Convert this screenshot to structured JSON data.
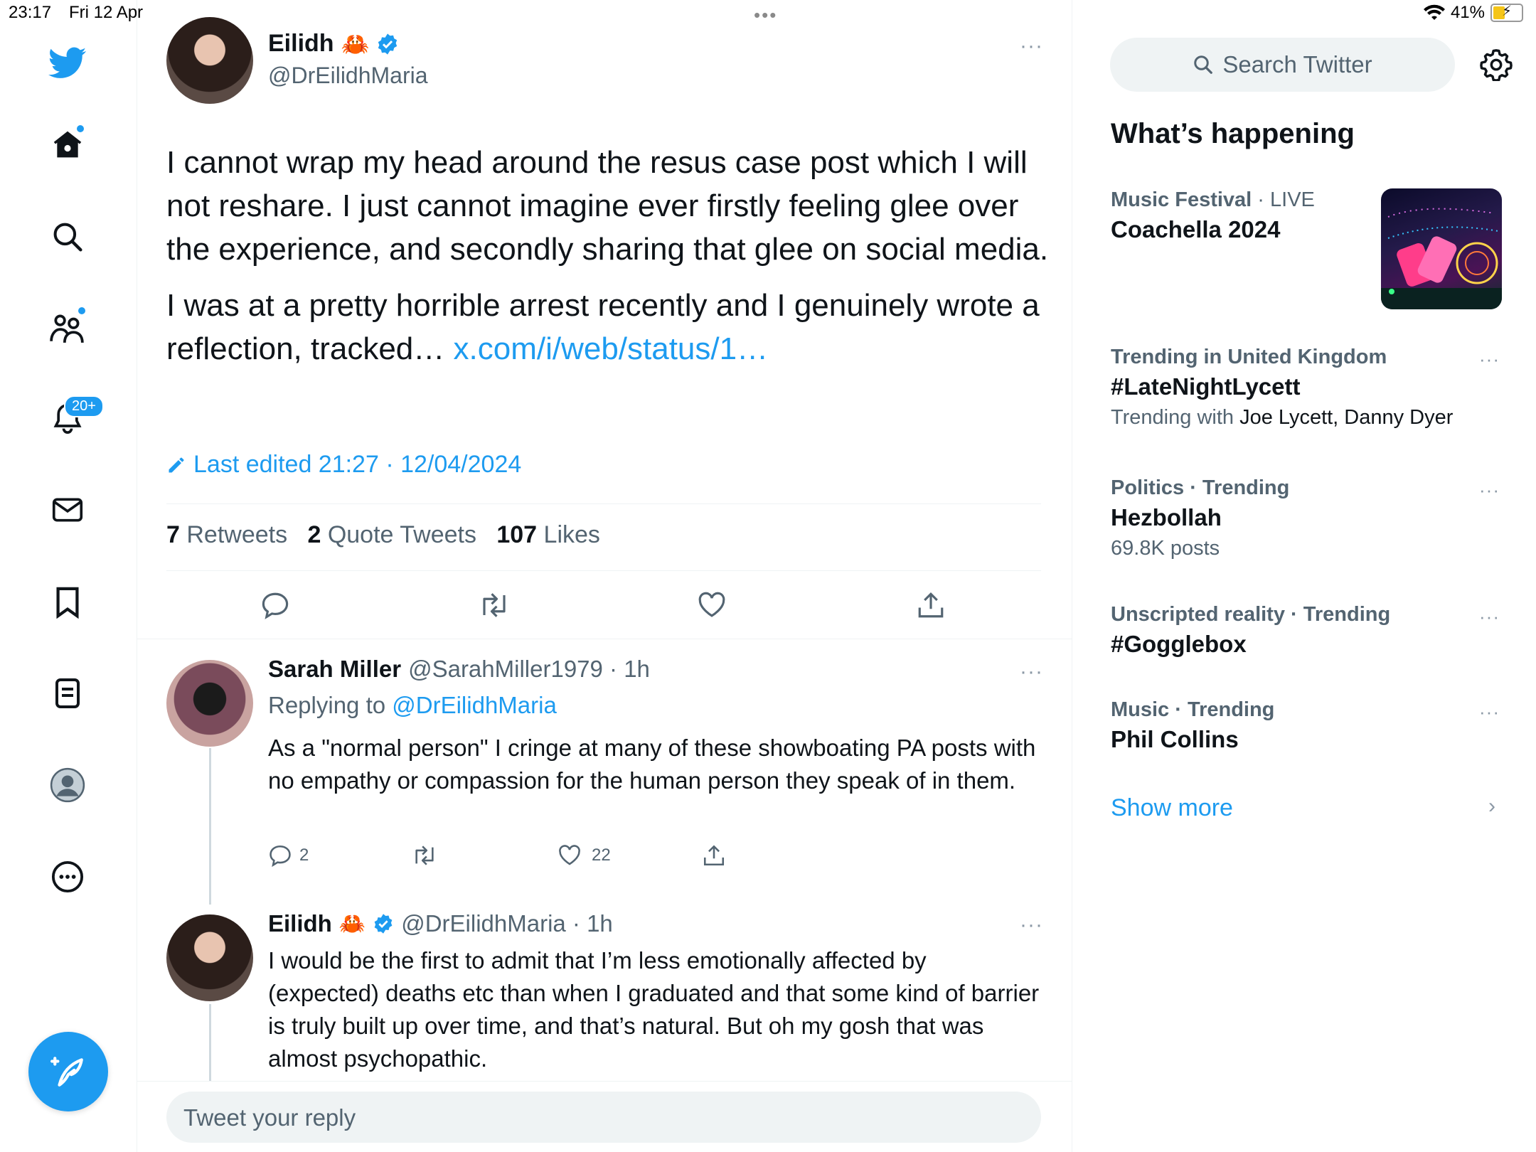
{
  "status_bar": {
    "time": "23:17",
    "date": "Fri 12 Apr",
    "battery": "41%"
  },
  "nav": {
    "notifications_badge": "20+"
  },
  "main_tweet": {
    "name": "Eilidh",
    "emoji": "🦀",
    "handle": "@DrEilidhMaria",
    "more": "···",
    "paragraph1": "I cannot wrap my head around the resus case post which I will not reshare. I just cannot imagine ever firstly feeling glee over the experience, and secondly sharing that glee on social media.",
    "paragraph2": "I was at a pretty horrible arrest recently and I genuinely wrote a reflection, tracked… ",
    "paragraph2_link": "x.com/i/web/status/1…",
    "edited": "Last edited 21:27 · 12/04/2024",
    "retweets_count": "7",
    "retweets_label": "Retweets",
    "quotes_count": "2",
    "quotes_label": "Quote Tweets",
    "likes_count": "107",
    "likes_label": "Likes"
  },
  "replies": [
    {
      "name": "Sarah Miller",
      "handle_time": "@SarahMiller1979 · 1h",
      "replying_prefix": "Replying to ",
      "replying_to": "@DrEilidhMaria",
      "text": "As a \"normal person\" I cringe at many of these showboating PA posts with no empathy or compassion for the human person they speak of in them.",
      "reply_count": "2",
      "like_count": "22"
    },
    {
      "name": "Eilidh",
      "emoji": "🦀",
      "handle_time": "@DrEilidhMaria · 1h",
      "text": "I would be the first to admit that I’m less emotionally affected by (expected) deaths etc than when I graduated and that some kind of barrier is truly built up over time, and that’s natural. But oh my gosh that was almost psychopathic."
    }
  ],
  "reply_box": {
    "placeholder": "Tweet your reply"
  },
  "sidebar": {
    "search_placeholder": "Search Twitter",
    "whats_happening": "What’s happening",
    "trends": [
      {
        "meta_a": "Music Festival",
        "meta_b": " · LIVE",
        "name": "Coachella 2024",
        "sub_a": "",
        "sub_b": ""
      },
      {
        "meta_a": "Trending in United Kingdom",
        "meta_b": "",
        "name": "#LateNightLycett",
        "sub_a": "Trending with ",
        "sub_b": "Joe Lycett, Danny Dyer"
      },
      {
        "meta_a": "Politics · Trending",
        "meta_b": "",
        "name": "Hezbollah",
        "sub_a": "69.8K posts",
        "sub_b": ""
      },
      {
        "meta_a": "Unscripted reality · Trending",
        "meta_b": "",
        "name": "#Gogglebox",
        "sub_a": "",
        "sub_b": ""
      },
      {
        "meta_a": "Music · Trending",
        "meta_b": "",
        "name": "Phil Collins",
        "sub_a": "",
        "sub_b": ""
      }
    ],
    "show_more": "Show more"
  },
  "colors": {
    "accent": "#1d9bf0",
    "text": "#0f1419",
    "muted": "#536471",
    "divider": "#eff3f4"
  }
}
